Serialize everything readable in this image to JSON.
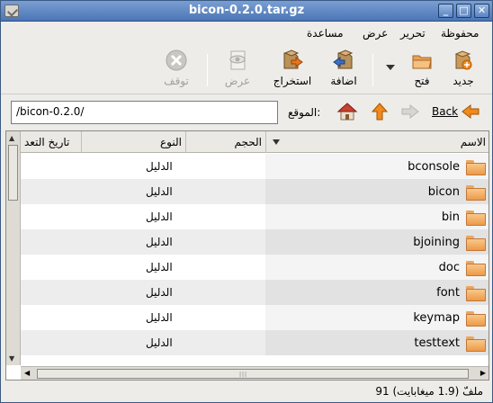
{
  "window": {
    "title": "bicon-0.2.0.tar.gz"
  },
  "menubar": {
    "items": [
      "محفوظة",
      "تحرير",
      "عرض",
      "مساعدة"
    ]
  },
  "toolbar": {
    "new_label": "جديد",
    "open_label": "فتح",
    "add_label": "اضافة",
    "extract_label": "استخراج",
    "view_label": "عرض",
    "stop_label": "توقف"
  },
  "location": {
    "back_label": "Back",
    "label": "الموقع:",
    "path": "/bicon-0.2.0/"
  },
  "columns": {
    "name": "الاسم",
    "size": "الحجم",
    "type": "النوع",
    "date": "تاريخ التعد"
  },
  "files": [
    {
      "name": "bconsole",
      "type": "الدليل"
    },
    {
      "name": "bicon",
      "type": "الدليل"
    },
    {
      "name": "bin",
      "type": "الدليل"
    },
    {
      "name": "bjoining",
      "type": "الدليل"
    },
    {
      "name": "doc",
      "type": "الدليل"
    },
    {
      "name": "font",
      "type": "الدليل"
    },
    {
      "name": "keymap",
      "type": "الدليل"
    },
    {
      "name": "testtext",
      "type": "الدليل"
    }
  ],
  "status": {
    "text": "91 ملفّ (1.9 ميغابايت)"
  },
  "colors": {
    "titlebar": "#4a76b6",
    "folder": "#ec9a48",
    "arrow": "#f08a1c"
  }
}
